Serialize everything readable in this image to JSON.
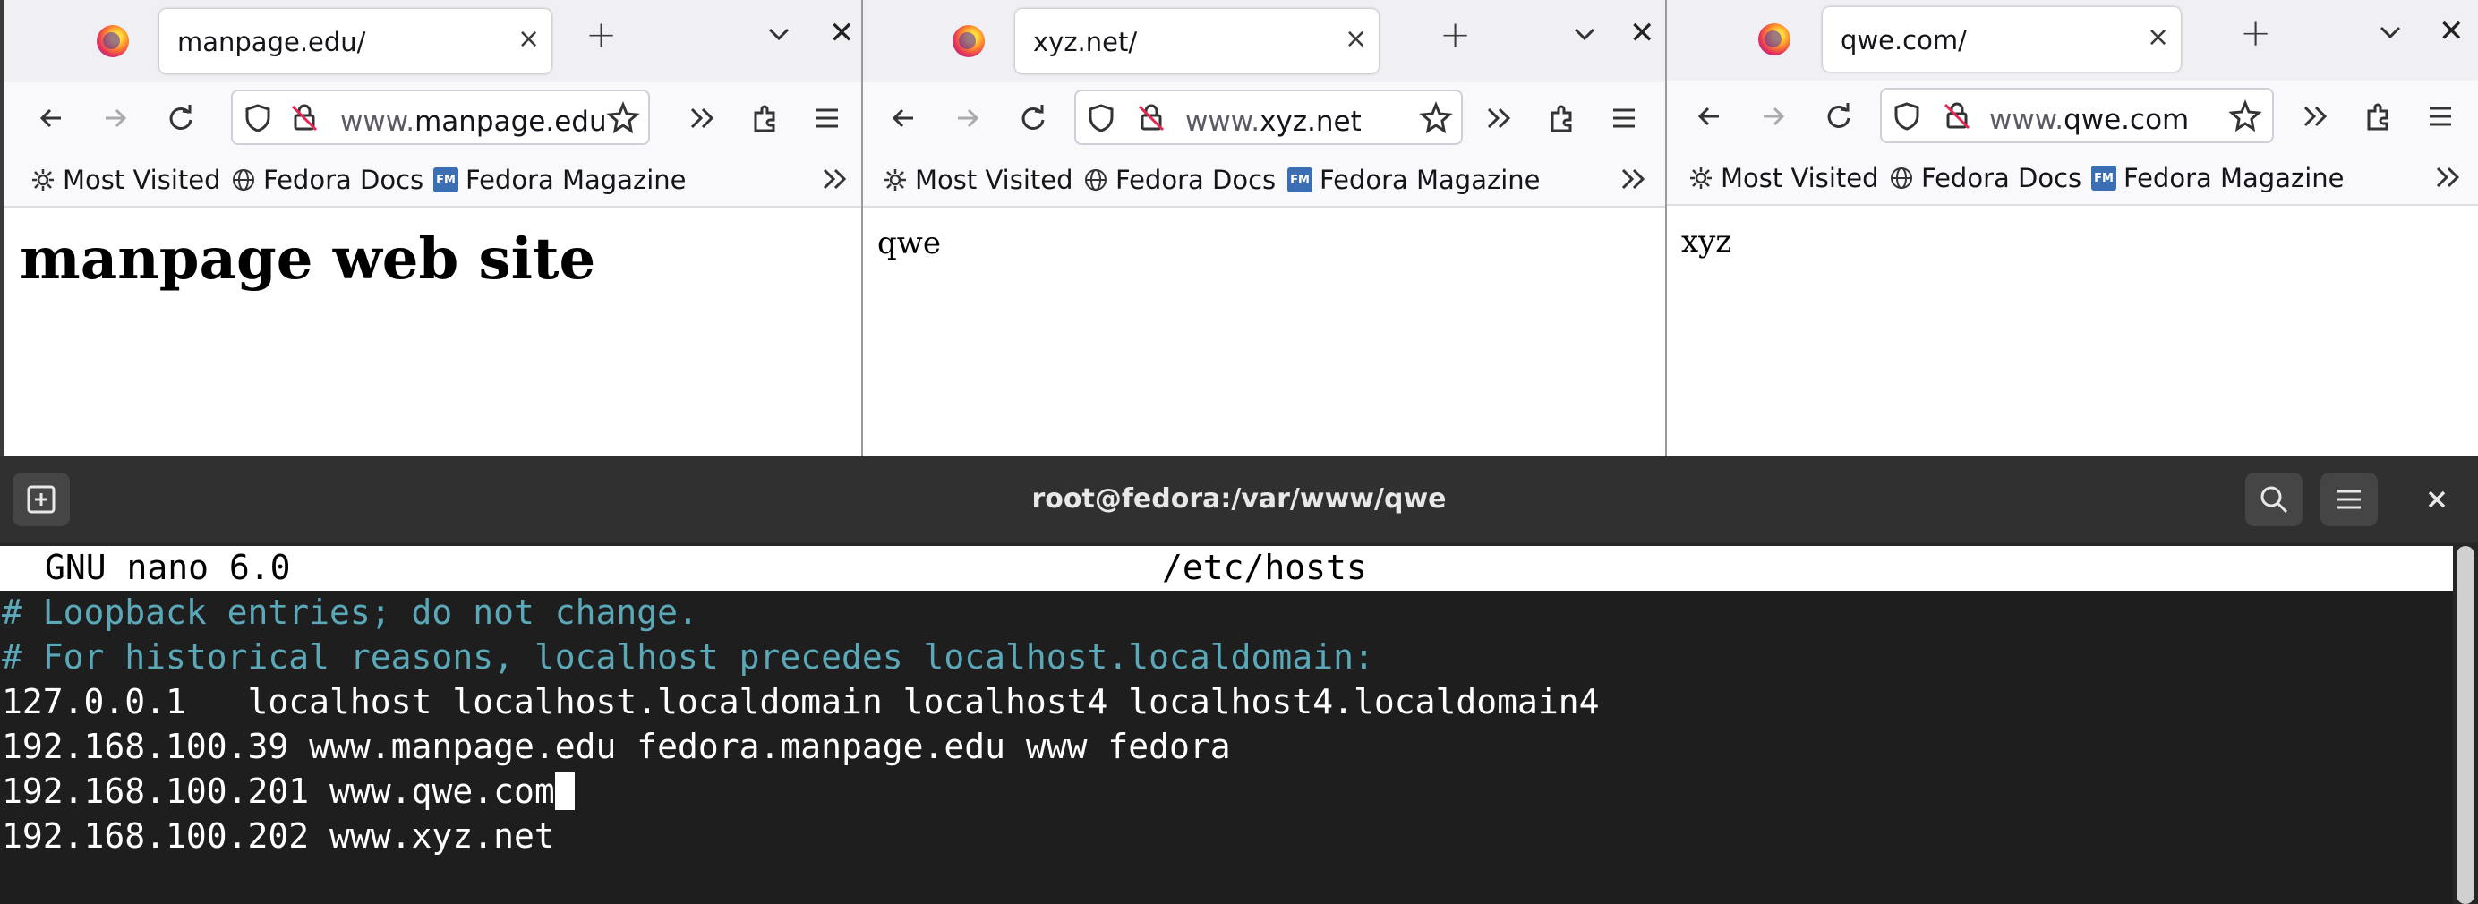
{
  "browsers": [
    {
      "tab_title": "manpage.edu/",
      "url_prefix": "www.",
      "url_domain": "manpage.edu",
      "bookmarks": [
        "Most Visited",
        "Fedora Docs",
        "Fedora Magazine"
      ],
      "page_heading": "manpage web site"
    },
    {
      "tab_title": "xyz.net/",
      "url_prefix": "www.",
      "url_domain": "xyz.net",
      "bookmarks": [
        "Most Visited",
        "Fedora Docs",
        "Fedora Magazine"
      ],
      "page_text": "qwe"
    },
    {
      "tab_title": "qwe.com/",
      "url_prefix": "www.",
      "url_domain": "qwe.com",
      "bookmarks": [
        "Most Visited",
        "Fedora Docs",
        "Fedora Magazine"
      ],
      "page_text": "xyz"
    }
  ],
  "icons": {
    "tab_close": "×",
    "new_tab": "+",
    "window_close": "✕",
    "overflow": "»"
  },
  "terminal": {
    "title": "root@fedora:/var/www/qwe",
    "nano": {
      "version": "GNU nano 6.0",
      "filename": "/etc/hosts",
      "lines": [
        "# Loopback entries; do not change.",
        "# For historical reasons, localhost precedes localhost.localdomain:",
        "127.0.0.1   localhost localhost.localdomain localhost4 localhost4.localdomain4",
        "192.168.100.39 www.manpage.edu fedora.manpage.edu www fedora",
        "192.168.100.201 www.qwe.com",
        "192.168.100.202 www.xyz.net"
      ]
    }
  },
  "colors": {
    "comment": "#5aa8b8",
    "fedora_magazine_badge": "#3c6eb4",
    "terminal_bg": "#1e1e1e",
    "terminal_header": "#303030"
  }
}
